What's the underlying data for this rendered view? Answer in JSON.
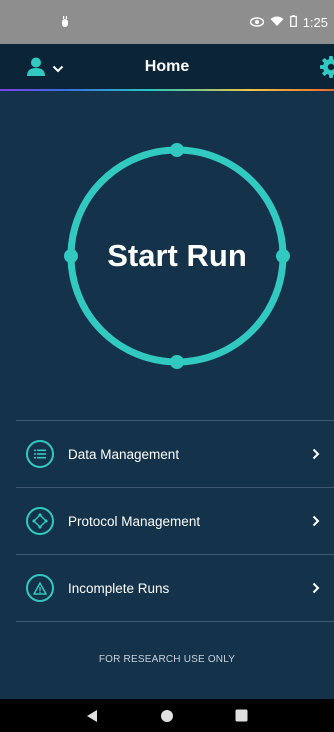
{
  "status_bar": {
    "time": "1:25"
  },
  "header": {
    "title": "Home",
    "user_icon": "user-icon",
    "settings_icon": "gear-icon"
  },
  "start_run": {
    "label": "Start Run"
  },
  "menu": {
    "items": [
      {
        "label": "Data Management",
        "icon": "list-icon"
      },
      {
        "label": "Protocol Management",
        "icon": "protocol-icon"
      },
      {
        "label": "Incomplete Runs",
        "icon": "warning-icon"
      }
    ]
  },
  "footer": {
    "text": "FOR RESEARCH USE ONLY"
  },
  "colors": {
    "background": "#14324a",
    "header": "#0c2438",
    "accent": "#31c9c0",
    "status_bar": "#8e8e8e",
    "nav_bar": "#000000"
  },
  "nav": {
    "icons": [
      "back-icon",
      "home-icon",
      "recents-icon"
    ]
  }
}
